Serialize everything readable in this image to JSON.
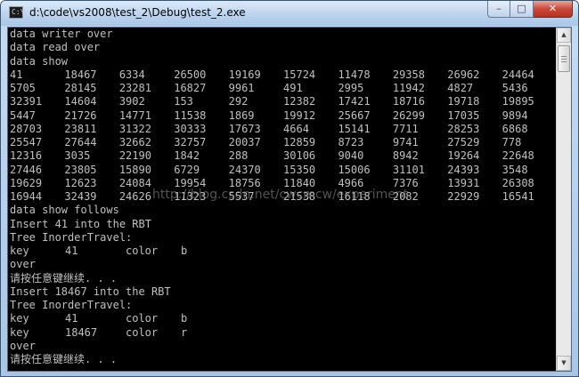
{
  "window": {
    "title": "d:\\code\\vs2008\\test_2\\Debug\\test_2.exe",
    "icon_glyph": "C:\\",
    "buttons": {
      "minimize": "–",
      "maximize": "□",
      "close": "✕"
    }
  },
  "console": {
    "intro_lines": [
      "data writer over",
      "data read over",
      "data show"
    ],
    "table": [
      [
        "41",
        "18467",
        "6334",
        "26500",
        "19169",
        "15724",
        "11478",
        "29358",
        "26962",
        "24464"
      ],
      [
        "5705",
        "28145",
        "23281",
        "16827",
        "9961",
        "491",
        "2995",
        "11942",
        "4827",
        "5436"
      ],
      [
        "32391",
        "14604",
        "3902",
        "153",
        "292",
        "12382",
        "17421",
        "18716",
        "19718",
        "19895"
      ],
      [
        "5447",
        "21726",
        "14771",
        "11538",
        "1869",
        "19912",
        "25667",
        "26299",
        "17035",
        "9894"
      ],
      [
        "28703",
        "23811",
        "31322",
        "30333",
        "17673",
        "4664",
        "15141",
        "7711",
        "28253",
        "6868"
      ],
      [
        "25547",
        "27644",
        "32662",
        "32757",
        "20037",
        "12859",
        "8723",
        "9741",
        "27529",
        "778"
      ],
      [
        "12316",
        "3035",
        "22190",
        "1842",
        "288",
        "30106",
        "9040",
        "8942",
        "19264",
        "22648"
      ],
      [
        "27446",
        "23805",
        "15890",
        "6729",
        "24370",
        "15350",
        "15006",
        "31101",
        "24393",
        "3548"
      ],
      [
        "19629",
        "12623",
        "24084",
        "19954",
        "18756",
        "11840",
        "4966",
        "7376",
        "13931",
        "26308"
      ],
      [
        "16944",
        "32439",
        "24626",
        "11323",
        "5537",
        "21538",
        "16118",
        "2082",
        "22929",
        "16541"
      ]
    ],
    "follow_line": "data show follows",
    "insert1": "Insert 41 into the RBT",
    "travel1": "Tree InorderTravel:",
    "kv1": [
      {
        "key": "key",
        "value": "41",
        "label": "color",
        "color": "b"
      }
    ],
    "over1": "over",
    "prompt1": "请按任意键继续. . .",
    "insert2": "Insert 18467 into the RBT",
    "travel2": "Tree InorderTravel:",
    "kv2": [
      {
        "key": "key",
        "value": "41",
        "label": "color",
        "color": "b"
      },
      {
        "key": "key",
        "value": "18467",
        "label": "color",
        "color": "r"
      }
    ],
    "over2": "over",
    "prompt2": "请按任意键继续. . ."
  },
  "watermark": "http://blog.csdn.net/cwcmcw/experiment",
  "scrollbar": {
    "up_icon": "▲",
    "down_icon": "▼"
  }
}
